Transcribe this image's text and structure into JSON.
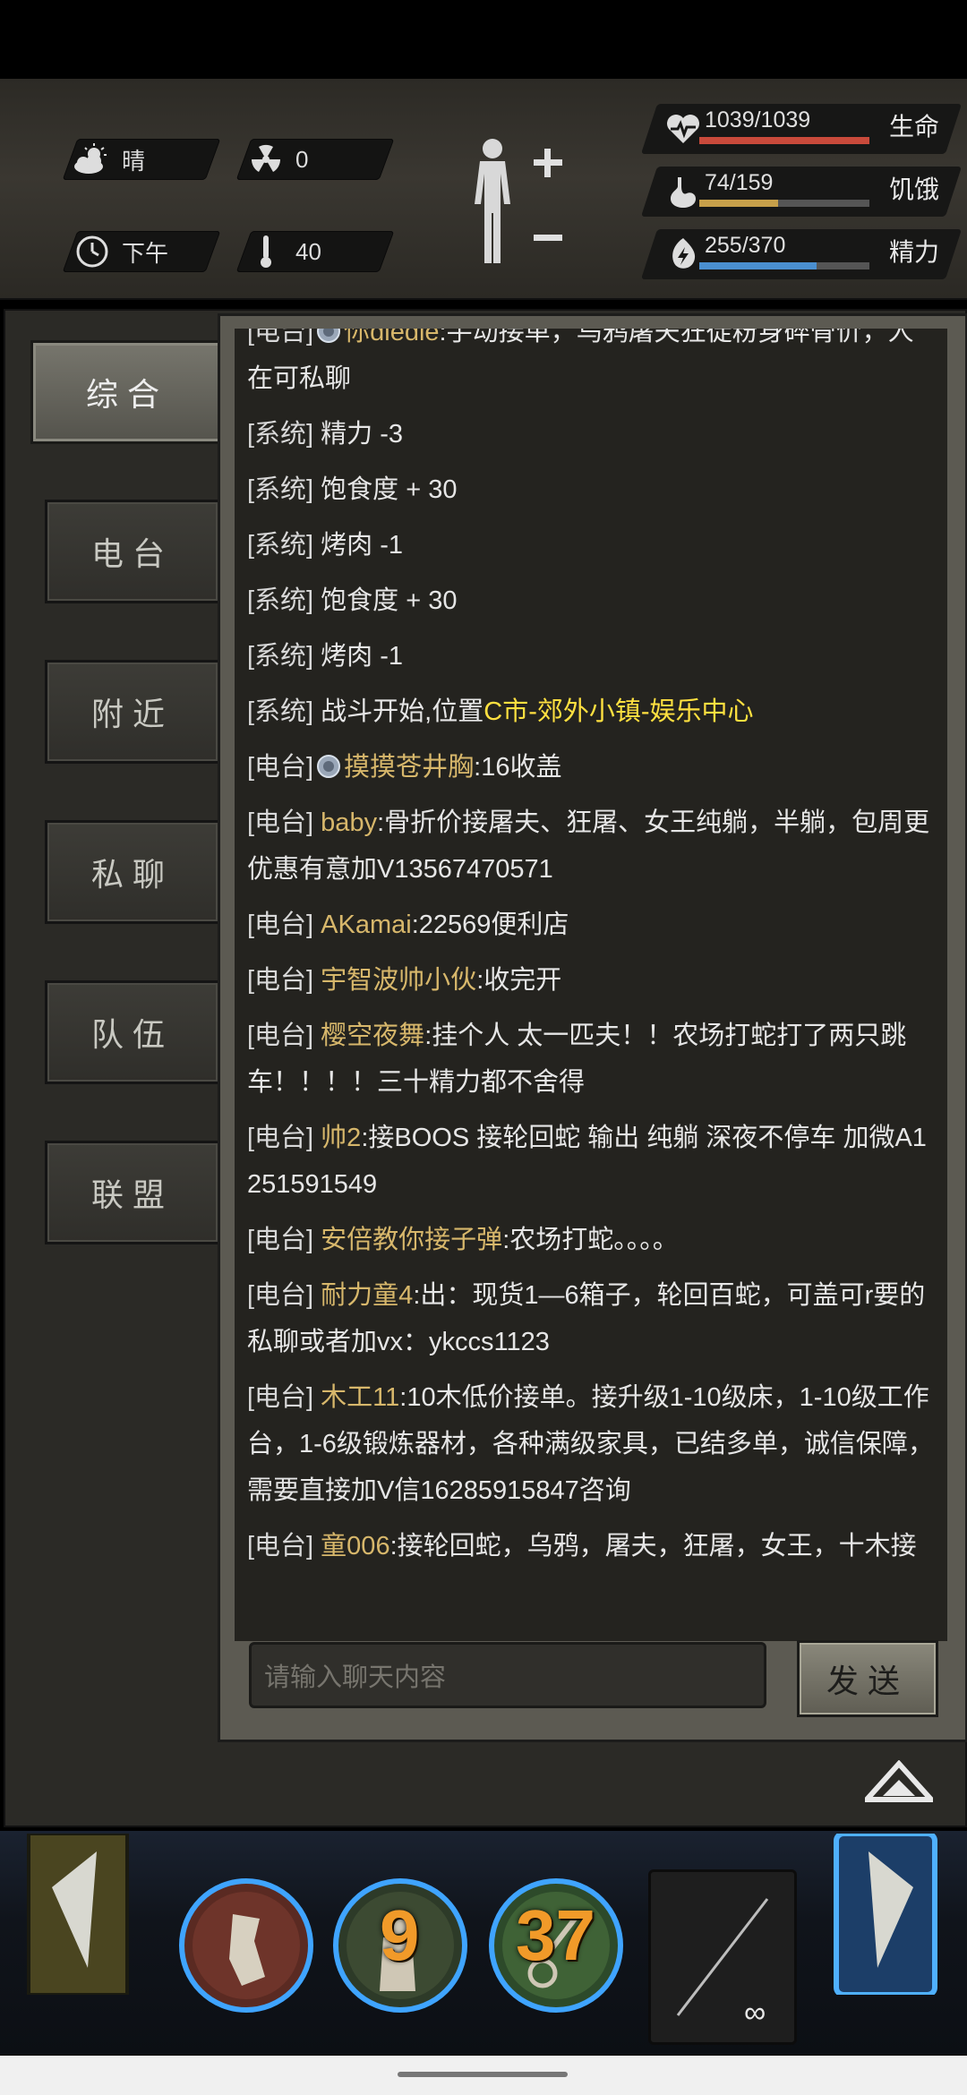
{
  "hud": {
    "weather": "晴",
    "radiation": "0",
    "time_of_day": "下午",
    "temperature": "40",
    "stats": [
      {
        "name": "生命",
        "value": "1039/1039",
        "fraction": 1.0,
        "color": "#c94a3b",
        "icon": "heart-pulse-icon"
      },
      {
        "name": "饥饿",
        "value": "74/159",
        "fraction": 0.465,
        "color": "#c7a04a",
        "icon": "stomach-icon"
      },
      {
        "name": "精力",
        "value": "255/370",
        "fraction": 0.689,
        "color": "#4a8fd0",
        "icon": "energy-icon"
      }
    ]
  },
  "tabs": [
    {
      "label": "综合",
      "active": true
    },
    {
      "label": "电台",
      "active": false
    },
    {
      "label": "附近",
      "active": false
    },
    {
      "label": "私聊",
      "active": false
    },
    {
      "label": "队伍",
      "active": false
    },
    {
      "label": "联盟",
      "active": false
    }
  ],
  "messages": [
    {
      "channel": "[电台]",
      "medal": true,
      "name": "你diedie",
      "text": ":手动接单，乌鸦屠夫狂徒粉身碎骨价，人在可私聊"
    },
    {
      "channel": "[系统]",
      "text": " 精力 -3"
    },
    {
      "channel": "[系统]",
      "text": " 饱食度 + 30"
    },
    {
      "channel": "[系统]",
      "text": " 烤肉 -1"
    },
    {
      "channel": "[系统]",
      "text": " 饱食度 + 30"
    },
    {
      "channel": "[系统]",
      "text": " 烤肉 -1"
    },
    {
      "channel": "[系统]",
      "text": " 战斗开始,位置",
      "location": "C市-郊外小镇-娱乐中心"
    },
    {
      "channel": "[电台]",
      "medal": true,
      "name": "摸摸苍井胸",
      "text": ":16收盖"
    },
    {
      "channel": "[电台]",
      "name": " baby",
      "text": ":骨折价接屠夫、狂屠、女王纯躺，半躺，包周更优惠有意加V13567470571"
    },
    {
      "channel": "[电台]",
      "name": " AKamai",
      "text": ":22569便利店"
    },
    {
      "channel": "[电台]",
      "name": " 宇智波帅小伙",
      "text": ":收完开"
    },
    {
      "channel": "[电台]",
      "name": " 樱空夜舞",
      "text": ":挂个人 太一匹夫！！农场打蛇打了两只跳车！！！！三十精力都不舍得"
    },
    {
      "channel": "[电台]",
      "name": " 帅2",
      "text": ":接BOOS 接轮回蛇 输出 纯躺 深夜不停车 加微A1251591549"
    },
    {
      "channel": "[电台]",
      "name": " 安倍教你接子弹",
      "text": ":农场打蛇。。。。"
    },
    {
      "channel": "[电台]",
      "name": " 耐力童4",
      "text": ":出：现货1—6箱子，轮回百蛇，可盖可r要的私聊或者加vx：ykccs1123"
    },
    {
      "channel": "[电台]",
      "name": " 木工11",
      "text": ":10木低价接单。接升级1-10级床，1-10级工作台，1-6级锻炼器材，各种满级家具，已结多单，诚信保障，需要直接加V信16285915847咨询"
    },
    {
      "channel": "[电台]",
      "name": " 童006",
      "text": ":接轮回蛇，乌鸦，屠夫，狂屠，女王，十木接"
    }
  ],
  "input": {
    "placeholder": "请输入聊天内容"
  },
  "send_label": "发送",
  "skills": {
    "count_1": "9",
    "count_2": "37",
    "slot_count": "∞"
  }
}
